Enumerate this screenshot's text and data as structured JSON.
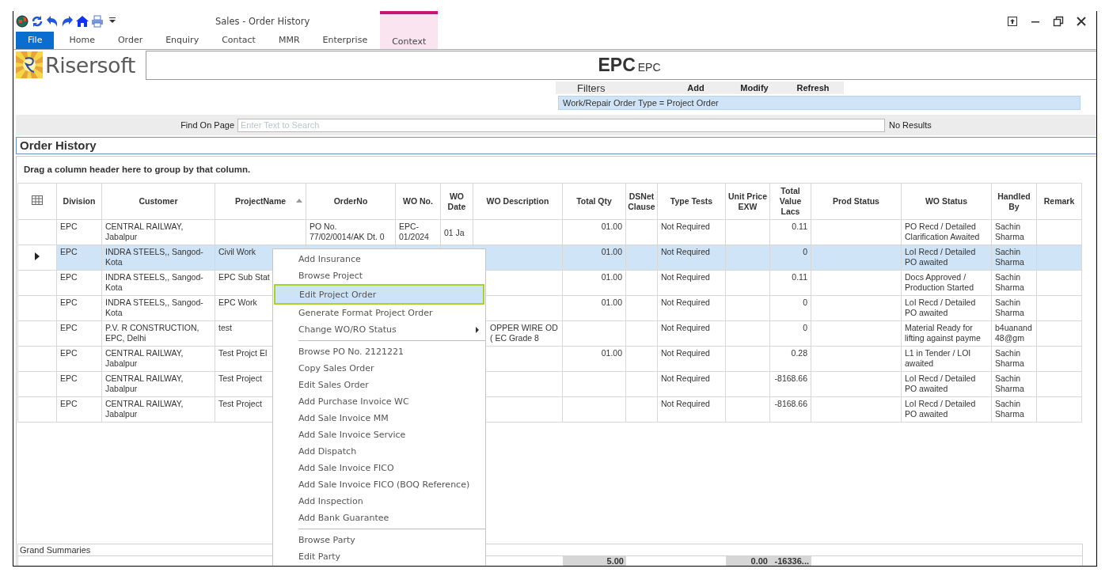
{
  "window": {
    "title": "Sales - Order History"
  },
  "quick_access": [
    {
      "kind": "globe"
    },
    {
      "kind": "refresh"
    },
    {
      "kind": "undo"
    },
    {
      "kind": "redo"
    },
    {
      "kind": "home"
    },
    {
      "kind": "print"
    },
    {
      "kind": "customize"
    }
  ],
  "window_controls": [
    {
      "kind": "ribbon"
    },
    {
      "kind": "minimize"
    },
    {
      "kind": "restore"
    },
    {
      "kind": "close"
    }
  ],
  "tabs": [
    {
      "label": "File",
      "kind": "file",
      "selected": false
    },
    {
      "label": "Home",
      "kind": "tab",
      "selected": false
    },
    {
      "label": "Order",
      "kind": "tab",
      "selected": false
    },
    {
      "label": "Enquiry",
      "kind": "tab",
      "selected": false
    },
    {
      "label": "Contact",
      "kind": "tab",
      "selected": false
    },
    {
      "label": "MMR",
      "kind": "tab",
      "selected": false
    },
    {
      "label": "Enterprise",
      "kind": "tab",
      "selected": false
    },
    {
      "label": "Context",
      "kind": "context",
      "selected": false
    }
  ],
  "brand": {
    "name": "Risersoft"
  },
  "header": {
    "title": "EPC",
    "subtitle": "EPC"
  },
  "filters": {
    "label": "Filters",
    "buttons": [
      "Add",
      "Modify",
      "Refresh"
    ],
    "active": [
      "Work/Repair Order Type = Project Order"
    ]
  },
  "find": {
    "label": "Find On Page",
    "placeholder": "Enter Text to Search",
    "result": "No Results"
  },
  "section_title": "Order History",
  "group_hint": "Drag a column header here to group by that column.",
  "table": {
    "columns": [
      {
        "label": "Division"
      },
      {
        "label": "Customer"
      },
      {
        "label": "ProjectName",
        "sorted": true
      },
      {
        "label": "OrderNo"
      },
      {
        "label": "WO No."
      },
      {
        "label": "WO Date"
      },
      {
        "label": "WO Description"
      },
      {
        "label": "Total Qty",
        "total": "5.00"
      },
      {
        "label": "DSNet Clause"
      },
      {
        "label": "Type Tests"
      },
      {
        "label": "Unit Price EXW",
        "total": "0.00"
      },
      {
        "label": "Total Value Lacs",
        "total": "-16336..."
      },
      {
        "label": "Prod Status"
      },
      {
        "label": "WO Status"
      },
      {
        "label": "Handled By"
      },
      {
        "label": "Remark"
      }
    ],
    "rows": [
      {
        "selected": false,
        "cells": [
          "EPC",
          "CENTRAL RAILWAY, Jabalpur",
          null,
          "PO No. 77/02/0014/AK Dt. 0",
          "EPC- 01/2024",
          "01 Ja",
          null,
          "01.00",
          null,
          "Not Required",
          null,
          "0.11",
          null,
          "PO Recd / Detailed Clarification Awaited",
          "Sachin Sharma",
          null
        ]
      },
      {
        "selected": true,
        "cells": [
          "EPC",
          "INDRA STEELS,, Sangod-Kota",
          "Civil Work",
          null,
          null,
          null,
          null,
          "01.00",
          null,
          "Not Required",
          null,
          "0",
          null,
          "LoI Recd / Detailed PO awaited",
          "Sachin Sharma",
          null
        ]
      },
      {
        "selected": false,
        "cells": [
          "EPC",
          "INDRA STEELS,, Sangod-Kota",
          "EPC Sub Stat",
          null,
          null,
          null,
          null,
          "01.00",
          null,
          "Not Required",
          null,
          "0.11",
          null,
          "Docs Approved / Production Started",
          "Sachin Sharma",
          null
        ]
      },
      {
        "selected": false,
        "cells": [
          "EPC",
          "INDRA STEELS,, Sangod-Kota",
          "EPC Work",
          null,
          null,
          null,
          null,
          "01.00",
          null,
          "Not Required",
          null,
          "0",
          null,
          "LoI Recd / Detailed PO awaited",
          "Sachin Sharma",
          null
        ]
      },
      {
        "selected": false,
        "cells": [
          "EPC",
          "P.V. R CONSTRUCTION, EPC, Delhi",
          "test",
          null,
          null,
          null,
          "OPPER WIRE OD ( EC Grade 8",
          null,
          null,
          "Not Required",
          null,
          "0",
          null,
          "Material Ready for lifting against payme",
          "b4uanand48@gm",
          null
        ]
      },
      {
        "selected": false,
        "cells": [
          "EPC",
          "CENTRAL RAILWAY, Jabalpur",
          "Test Projct El",
          null,
          null,
          null,
          null,
          "01.00",
          null,
          "Not Required",
          null,
          "0.28",
          null,
          "L1 in Tender / LOI awaited",
          "Sachin Sharma",
          null
        ]
      },
      {
        "selected": false,
        "cells": [
          "EPC",
          "CENTRAL RAILWAY, Jabalpur",
          "Test Project",
          null,
          null,
          null,
          null,
          null,
          null,
          "Not Required",
          null,
          "-8168.66",
          null,
          "LoI Recd / Detailed PO awaited",
          "Sachin Sharma",
          null
        ]
      },
      {
        "selected": false,
        "cells": [
          "EPC",
          "CENTRAL RAILWAY, Jabalpur",
          "Test Project",
          null,
          null,
          null,
          null,
          null,
          null,
          "Not Required",
          null,
          "-8168.66",
          null,
          "LoI Recd / Detailed PO awaited",
          "Sachin Sharma",
          null
        ]
      }
    ]
  },
  "summary": {
    "label": "Grand Summaries"
  },
  "context_menu": [
    {
      "label": "Add Insurance",
      "selected": false
    },
    {
      "label": "Browse  Project",
      "selected": false
    },
    {
      "label": "Edit Project Order",
      "selected": true
    },
    {
      "label": "Generate Format Project Order",
      "selected": false
    },
    {
      "label": "Change WO/RO Status",
      "selected": false,
      "submenu": true
    },
    {
      "label": "Browse  PO No. 2121221",
      "selected": false,
      "separator_before": true
    },
    {
      "label": "Copy Sales Order",
      "selected": false
    },
    {
      "label": "Edit Sales Order",
      "selected": false
    },
    {
      "label": "Add Purchase Invoice WC",
      "selected": false
    },
    {
      "label": "Add Sale Invoice MM",
      "selected": false
    },
    {
      "label": "Add Sale Invoice Service",
      "selected": false
    },
    {
      "label": "Add Dispatch",
      "selected": false
    },
    {
      "label": "Add Sale Invoice FICO",
      "selected": false
    },
    {
      "label": "Add Sale Invoice FICO (BOQ Reference)",
      "selected": false
    },
    {
      "label": "Add Inspection",
      "selected": false
    },
    {
      "label": "Add Bank Guarantee",
      "selected": false
    },
    {
      "label": "Browse  Party",
      "selected": false,
      "separator_before": true
    },
    {
      "label": "Edit Party",
      "selected": false
    }
  ]
}
